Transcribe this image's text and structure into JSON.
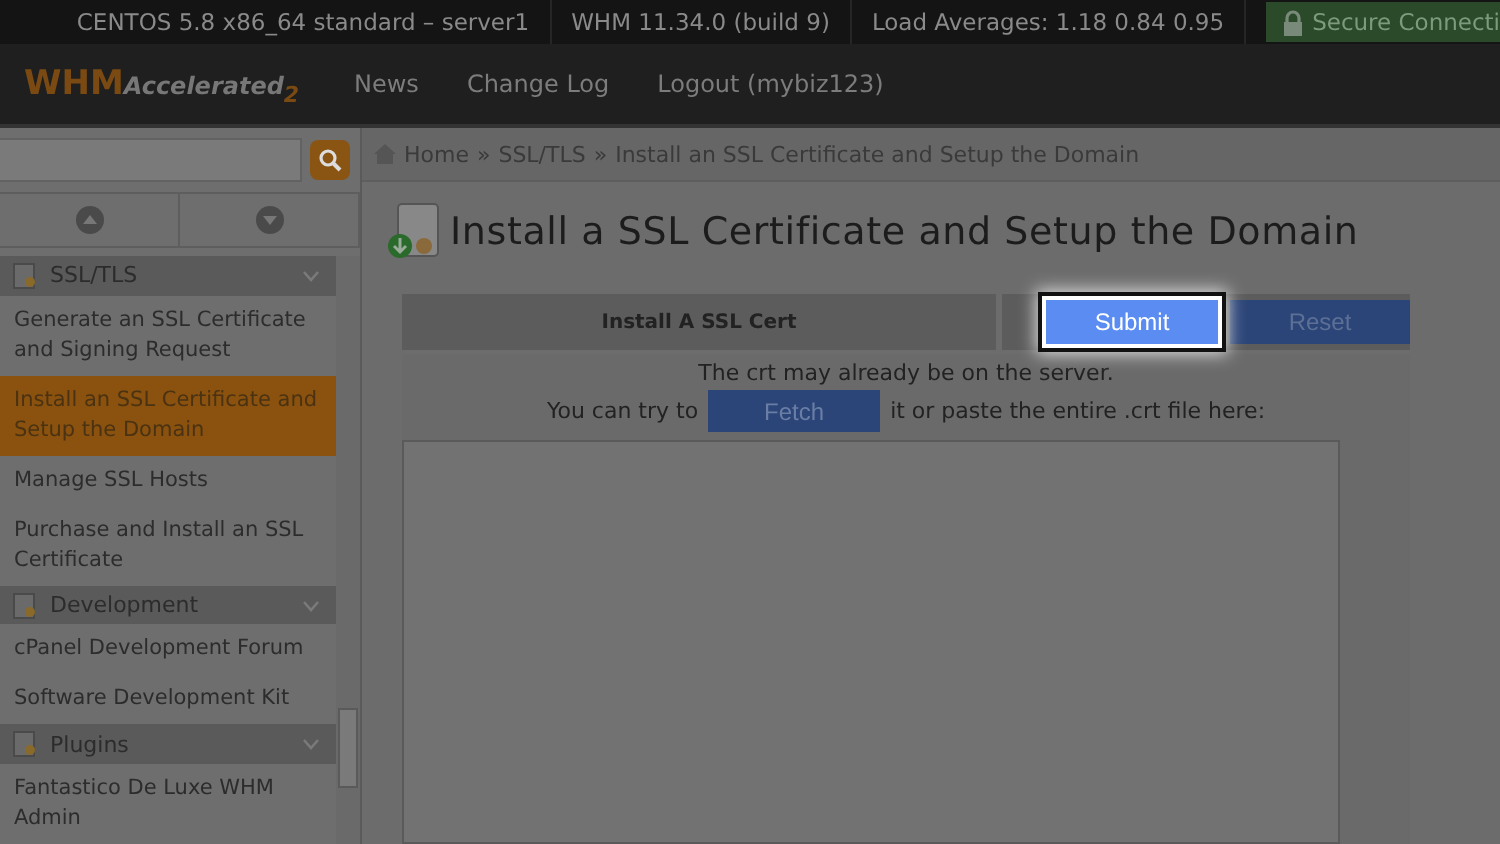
{
  "top_bar": {
    "items": [
      "CENTOS 5.8 x86_64 standard – server1",
      "WHM 11.34.0 (build 9)",
      "Load Averages: 1.18 0.84 0.95"
    ],
    "secure": "Secure Connecti"
  },
  "header": {
    "logo": "WHM",
    "logo_sub": "Accelerated",
    "logo_num": "2",
    "nav": [
      "News",
      "Change Log",
      "Logout (mybiz123)"
    ]
  },
  "sidebar": {
    "sections": [
      {
        "title": "SSL/TLS",
        "items": [
          {
            "label": "Generate an SSL Certificate and Signing Request",
            "selected": false
          },
          {
            "label": "Install an SSL Certificate and Setup the Domain",
            "selected": true
          },
          {
            "label": "Manage SSL Hosts",
            "selected": false
          },
          {
            "label": "Purchase and Install an SSL Certificate",
            "selected": false
          }
        ]
      },
      {
        "title": "Development",
        "items": [
          {
            "label": "cPanel Development Forum",
            "selected": false
          },
          {
            "label": "Software Development Kit",
            "selected": false
          }
        ]
      },
      {
        "title": "Plugins",
        "items": [
          {
            "label": "Fantastico De Luxe WHM Admin",
            "selected": false
          }
        ]
      }
    ]
  },
  "breadcrumb": {
    "items": [
      "Home",
      "SSL/TLS",
      "Install an SSL Certificate and Setup the Domain"
    ],
    "separator": "»"
  },
  "title": "Install a SSL Certificate and Setup the Domain",
  "form": {
    "tab": "Install A SSL Cert",
    "buttons": [
      {
        "label": "Submit",
        "highlighted": true
      },
      {
        "label": "Reset",
        "highlighted": false
      }
    ],
    "note": "The crt may already be on the server.",
    "fetch_before": "You can try to",
    "fetch_button": "Fetch",
    "fetch_after": "it or paste the entire .crt file here:"
  }
}
